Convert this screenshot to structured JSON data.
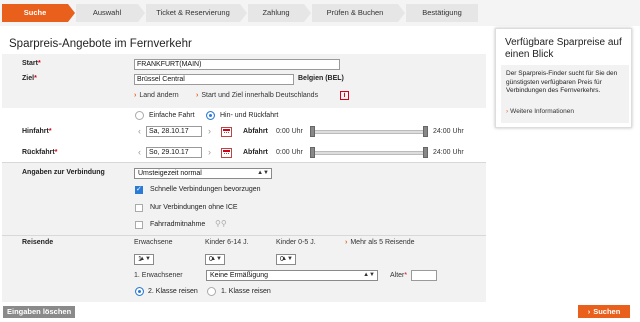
{
  "steps": [
    "Suche",
    "Auswahl",
    "Ticket & Reservierung",
    "Zahlung",
    "Prüfen & Buchen",
    "Bestätigung"
  ],
  "active_step": "Suche",
  "page_title": "Sparpreis-Angebote im Fernverkehr",
  "start": {
    "label": "Start",
    "required_mark": "*",
    "value": "FRANKFURT(MAIN)"
  },
  "ziel": {
    "label": "Ziel",
    "required_mark": "*",
    "value": "Brüssel Central",
    "country": "Belgien (BEL)"
  },
  "links": {
    "land_aendern": "Land ändern",
    "start_ziel_de": "Start und Ziel innerhalb Deutschlands",
    "info_icon": "i"
  },
  "trip_type": {
    "option_single": "Einfache Fahrt",
    "option_return": "Hin- und Rückfahrt",
    "selected": "Hin- und Rückfahrt"
  },
  "hinfahrt": {
    "label": "Hinfahrt",
    "required_mark": "*",
    "date": "Sa, 28.10.17",
    "mode": "Abfahrt",
    "time_from": "0:00 Uhr",
    "time_to": "24:00 Uhr"
  },
  "rueckfahrt": {
    "label": "Rückfahrt",
    "required_mark": "*",
    "date": "So, 29.10.17",
    "mode": "Abfahrt",
    "time_from": "0:00 Uhr",
    "time_to": "24:00 Uhr"
  },
  "verbindung": {
    "label": "Angaben zur Verbindung",
    "transfer_select": "Umsteigezeit normal",
    "opt_fast": "Schnelle Verbindungen bevorzugen",
    "opt_fast_checked": true,
    "opt_no_ice": "Nur Verbindungen ohne ICE",
    "opt_no_ice_checked": false,
    "opt_bike": "Fahrradmitnahme",
    "opt_bike_checked": false
  },
  "reisende": {
    "label": "Reisende",
    "col_adults": "Erwachsene",
    "col_children": "Kinder 6-14 J.",
    "col_infants": "Kinder 0-5 J.",
    "more_link": "Mehr als 5 Reisende",
    "adults": "1",
    "children": "0",
    "infants": "0",
    "first_adult": "1. Erwachsener",
    "discount": "Keine Ermäßigung",
    "age_label": "Alter",
    "age_required": "*",
    "age_value": "",
    "class_2": "2. Klasse reisen",
    "class_1": "1. Klasse reisen",
    "class_selected": "2. Klasse reisen"
  },
  "buttons": {
    "clear": "Eingaben löschen",
    "search": "Suchen"
  },
  "infobox": {
    "title": "Verfügbare Sparpreise auf einen Blick",
    "text": "Der Sparpreis-Finder sucht für Sie den günstigsten verfügbaren Preis für Verbindungen des Fernverkehrs.",
    "link": "Weitere Informationen"
  },
  "colors": {
    "accent": "#e8601c",
    "required": "#d0021b",
    "selection": "#2a7ad6"
  },
  "icons": [
    "arrow-right-icon",
    "info-icon",
    "calendar-icon",
    "chevron-left-icon",
    "chevron-right-icon",
    "bicycle-icon"
  ]
}
